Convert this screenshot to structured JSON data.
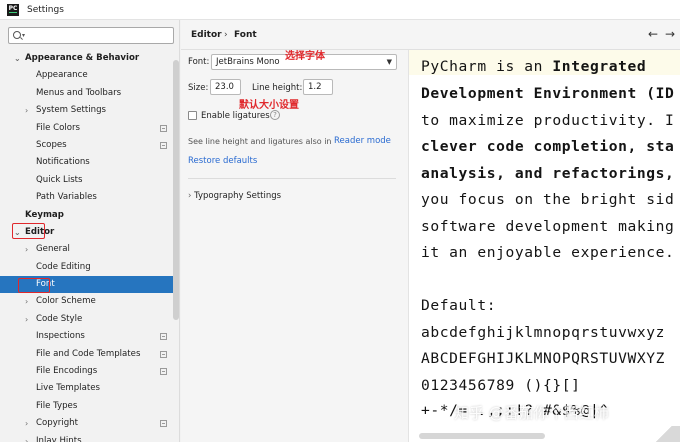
{
  "window": {
    "title": "Settings",
    "app_icon_text": "PC"
  },
  "search": {
    "placeholder": ""
  },
  "sidebar": {
    "items": [
      {
        "label": "Appearance & Behavior",
        "level": 0,
        "expanded": true,
        "bold": true
      },
      {
        "label": "Appearance",
        "level": 1
      },
      {
        "label": "Menus and Toolbars",
        "level": 1
      },
      {
        "label": "System Settings",
        "level": 1,
        "collapsed": true
      },
      {
        "label": "File Colors",
        "level": 1,
        "project": true
      },
      {
        "label": "Scopes",
        "level": 1,
        "project": true
      },
      {
        "label": "Notifications",
        "level": 1
      },
      {
        "label": "Quick Lists",
        "level": 1
      },
      {
        "label": "Path Variables",
        "level": 1
      },
      {
        "label": "Keymap",
        "level": 0,
        "bold": true
      },
      {
        "label": "Editor",
        "level": 0,
        "expanded": true,
        "bold": true
      },
      {
        "label": "General",
        "level": 1,
        "collapsed": true
      },
      {
        "label": "Code Editing",
        "level": 1
      },
      {
        "label": "Font",
        "level": 1,
        "selected": true
      },
      {
        "label": "Color Scheme",
        "level": 1,
        "collapsed": true
      },
      {
        "label": "Code Style",
        "level": 1,
        "collapsed": true
      },
      {
        "label": "Inspections",
        "level": 1,
        "project": true
      },
      {
        "label": "File and Code Templates",
        "level": 1,
        "project": true
      },
      {
        "label": "File Encodings",
        "level": 1,
        "project": true
      },
      {
        "label": "Live Templates",
        "level": 1
      },
      {
        "label": "File Types",
        "level": 1
      },
      {
        "label": "Copyright",
        "level": 1,
        "collapsed": true,
        "project": true
      },
      {
        "label": "Inlay Hints",
        "level": 1,
        "collapsed": true
      }
    ]
  },
  "breadcrumb": {
    "parent": "Editor",
    "separator": "›",
    "current": "Font"
  },
  "nav": {
    "back": "←",
    "forward": "→"
  },
  "font_settings": {
    "font_label": "Font:",
    "font_value": "JetBrains Mono",
    "size_label": "Size:",
    "size_value": "23.0",
    "line_height_label": "Line height:",
    "line_height_value": "1.2",
    "ligatures_label": "Enable ligatures",
    "ligatures_help": "?",
    "ligatures_checked": false,
    "hint_text": "See line height and ligatures also in",
    "hint_link": "Reader mode",
    "restore_link": "Restore defaults",
    "typography_label": "Typography Settings"
  },
  "annotations": {
    "choose_font": "选择字体",
    "default_size": "默认大小设置",
    "color": "#e0282c"
  },
  "preview": {
    "lines": [
      [
        {
          "t": "PyCharm is an ",
          "b": false
        },
        {
          "t": "Integrated",
          "b": true
        }
      ],
      [
        {
          "t": "Development Environment (ID",
          "b": true
        }
      ],
      [
        {
          "t": "to maximize productivity. I",
          "b": false
        }
      ],
      [
        {
          "t": "clever code completion, sta",
          "b": true
        }
      ],
      [
        {
          "t": "analysis, and refactorings,",
          "b": true
        }
      ],
      [
        {
          "t": "you focus on the bright sid",
          "b": false
        }
      ],
      [
        {
          "t": "software development making",
          "b": false
        }
      ],
      [
        {
          "t": "it an enjoyable experience.",
          "b": false
        }
      ],
      [
        {
          "t": "",
          "b": false
        }
      ],
      [
        {
          "t": "Default:",
          "b": false
        }
      ],
      [
        {
          "t": "abcdefghijklmnopqrstuvwxyz",
          "b": false
        }
      ],
      [
        {
          "t": "ABCDEFGHIJKLMNOPQRSTUVWXYZ",
          "b": false
        }
      ],
      [
        {
          "t": " 0123456789 (){}[]",
          "b": false
        }
      ],
      [
        {
          "t": " +-*/= .,;:!? #&$%@|^",
          "b": false
        }
      ]
    ]
  },
  "watermark": "知乎 @番茄你个西红柿",
  "colors": {
    "selection": "#2675bf",
    "link": "#2a6bd1",
    "highlight_line": "#fdfbea"
  }
}
